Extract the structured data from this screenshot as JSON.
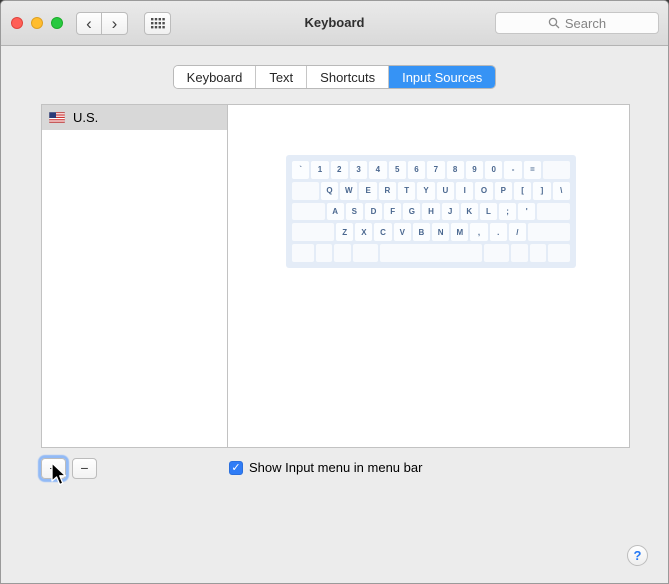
{
  "window": {
    "title": "Keyboard",
    "accent_color": "#3693f5",
    "selection_color": "#d8d8d8"
  },
  "titlebar": {
    "search_placeholder": "Search"
  },
  "icons": {
    "back": "‹",
    "forward": "›",
    "add": "+",
    "remove": "−",
    "help": "?",
    "checkmark": "✓"
  },
  "tabs": [
    {
      "label": "Keyboard",
      "active": false
    },
    {
      "label": "Text",
      "active": false
    },
    {
      "label": "Shortcuts",
      "active": false
    },
    {
      "label": "Input Sources",
      "active": true
    }
  ],
  "input_sources": [
    {
      "label": "U.S.",
      "flag": "us-flag",
      "selected": true
    }
  ],
  "keyboard_preview": {
    "rows": [
      [
        "`",
        "1",
        "2",
        "3",
        "4",
        "5",
        "6",
        "7",
        "8",
        "9",
        "0",
        "-",
        "="
      ],
      [
        "Q",
        "W",
        "E",
        "R",
        "T",
        "Y",
        "U",
        "I",
        "O",
        "P",
        "[",
        "]",
        "\\"
      ],
      [
        "A",
        "S",
        "D",
        "F",
        "G",
        "H",
        "J",
        "K",
        "L",
        ";",
        "'"
      ],
      [
        "Z",
        "X",
        "C",
        "V",
        "B",
        "N",
        "M",
        ",",
        ".",
        "/"
      ],
      []
    ]
  },
  "controls": {
    "show_input_menu": {
      "label": "Show Input menu in menu bar",
      "checked": true
    }
  }
}
